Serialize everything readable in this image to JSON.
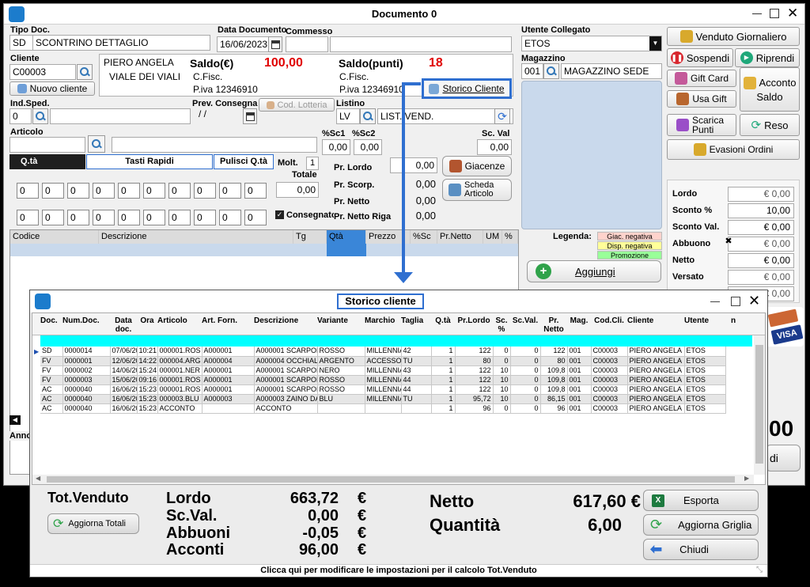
{
  "main": {
    "title": "Documento 0",
    "tipo_doc": {
      "label": "Tipo Doc.",
      "code": "SD",
      "desc": "SCONTRINO DETTAGLIO"
    },
    "data_doc": {
      "label": "Data Documento",
      "value": "16/06/2023"
    },
    "commesso": {
      "label": "Commesso"
    },
    "utente": {
      "label": "Utente Collegato",
      "value": "ETOS"
    },
    "cliente": {
      "label": "Cliente",
      "code": "C00003",
      "new_btn": "Nuovo cliente",
      "name": "PIERO ANGELA",
      "address": "VIALE DEI VIALI"
    },
    "saldo_eur": {
      "label": "Saldo(€)",
      "value": "100,00",
      "cfisc": "C.Fisc.",
      "piva": "P.iva 12346910"
    },
    "saldo_punti": {
      "label": "Saldo(punti)",
      "value": "18",
      "cfisc": "C.Fisc.",
      "piva": "P.iva 12346910"
    },
    "storico_btn": "Storico Cliente",
    "magazzino": {
      "label": "Magazzino",
      "code": "001",
      "desc": "MAGAZZINO SEDE"
    },
    "ind_sped": {
      "label": "Ind.Sped.",
      "value": "0"
    },
    "prev_consegna": {
      "label": "Prev. Consegna",
      "value": "/ /"
    },
    "cod_lotteria": "Cod. Lotteria",
    "listino": {
      "label": "Listino",
      "code": "LV",
      "desc": "LIST. VEND."
    },
    "articolo": {
      "label": "Articolo"
    },
    "sc1": {
      "label": "%Sc1",
      "value": "0,00"
    },
    "sc2": {
      "label": "%Sc2",
      "value": "0,00"
    },
    "scval": {
      "label": "Sc. Val",
      "value": "0,00"
    },
    "tabs": {
      "qta": "Q.tà",
      "tasti": "Tasti Rapidi",
      "pulisci": "Pulisci Q.tà"
    },
    "qty_cells": [
      "0",
      "0",
      "0",
      "0",
      "0",
      "0",
      "0",
      "0",
      "0",
      "0"
    ],
    "molt": {
      "label": "Molt.",
      "value": "1"
    },
    "totale": {
      "label": "Totale",
      "value": "0,00"
    },
    "consegnato": "Consegnato",
    "prezzi": {
      "lordo": {
        "label": "Pr. Lordo",
        "value": "0,00"
      },
      "scorp": {
        "label": "Pr. Scorp.",
        "value": "0,00"
      },
      "netto": {
        "label": "Pr. Netto",
        "value": "0,00"
      },
      "netto_riga": {
        "label": "Pr. Netto Riga",
        "value": "0,00"
      }
    },
    "giacenze": "Giacenze",
    "scheda": "Scheda Articolo",
    "grid_cols": [
      "Codice",
      "Descrizione",
      "Tg",
      "Qtà",
      "Prezzo",
      "%Sc",
      "Pr.Netto",
      "UM",
      "%"
    ],
    "legenda": {
      "label": "Legenda:",
      "giac": "Giac. negativa",
      "disp": "Disp. negativa",
      "promo": "Promozione"
    },
    "aggiungi": "Aggiungi",
    "anno": "Anno",
    "right_buttons": {
      "venduto": "Venduto Giornaliero",
      "sospendi": "Sospendi",
      "riprendi": "Riprendi",
      "gift_card": "Gift Card",
      "acconto": "Acconto",
      "usa_gift": "Usa Gift",
      "saldo": "Saldo",
      "scarica_punti": "Scarica Punti",
      "reso": "Reso",
      "evasioni": "Evasioni Ordini"
    },
    "summary": [
      {
        "label": "Lordo",
        "value": "€ 0,00"
      },
      {
        "label": "Sconto %",
        "value": "10,00"
      },
      {
        "label": "Sconto Val.",
        "value": "€ 0,00"
      },
      {
        "label": "Abbuono",
        "value": "€ 0,00"
      },
      {
        "label": "Netto",
        "value": "€ 0,00"
      },
      {
        "label": "Versato",
        "value": "€ 0,00"
      },
      {
        "label": "",
        "value": "€ 0,00"
      }
    ],
    "big_total_partial": "00",
    "chiudi_partial": "di"
  },
  "storico": {
    "title": "Storico cliente",
    "columns": [
      "Doc.",
      "Num.Doc.",
      "Data doc.",
      "Ora",
      "Articolo",
      "Art. Forn.",
      "Descrizione",
      "Variante",
      "Marchio",
      "Taglia",
      "Q.tà",
      "Pr.Lordo",
      "Sc. %",
      "Sc.Val.",
      "Pr. Netto",
      "Mag.",
      "Cod.Cli.",
      "Cliente",
      "Utente",
      "n"
    ],
    "rows": [
      [
        "SD",
        "0000014",
        "07/06/20",
        "10:21",
        "000001.ROS",
        "A000001",
        "A000001 SCARPONC",
        "ROSSO",
        "MILLENNIAL",
        "42",
        "1",
        "122",
        "0",
        "0",
        "122",
        "001",
        "C00003",
        "PIERO ANGELA",
        "ETOS"
      ],
      [
        "FV",
        "0000001",
        "12/06/20",
        "14:22",
        "000004.ARG",
        "A000004",
        "A000004 OCCHIALI",
        "ARGENTO",
        "ACCESSOR",
        "TU",
        "1",
        "80",
        "0",
        "0",
        "80",
        "001",
        "C00003",
        "PIERO ANGELA",
        "ETOS"
      ],
      [
        "FV",
        "0000002",
        "14/06/20",
        "15:24",
        "000001.NER",
        "A000001",
        "A000001 SCARPONC",
        "NERO",
        "MILLENNIAL",
        "43",
        "1",
        "122",
        "10",
        "0",
        "109,8",
        "001",
        "C00003",
        "PIERO ANGELA",
        "ETOS"
      ],
      [
        "FV",
        "0000003",
        "15/06/20",
        "09:16",
        "000001.ROS",
        "A000001",
        "A000001 SCARPONC",
        "ROSSO",
        "MILLENNIAL",
        "44",
        "1",
        "122",
        "10",
        "0",
        "109,8",
        "001",
        "C00003",
        "PIERO ANGELA",
        "ETOS"
      ],
      [
        "AC",
        "0000040",
        "16/06/20",
        "15:23",
        "000001.ROS",
        "A000001",
        "A000001 SCARPONC",
        "ROSSO",
        "MILLENNIAL",
        "44",
        "1",
        "122",
        "10",
        "0",
        "109,8",
        "001",
        "C00003",
        "PIERO ANGELA",
        "ETOS"
      ],
      [
        "AC",
        "0000040",
        "16/06/20",
        "15:23",
        "000003.BLU",
        "A000003",
        "A000003 ZAINO DA",
        "BLU",
        "MILLENNIAL",
        "TU",
        "1",
        "95,72",
        "10",
        "0",
        "86,15",
        "001",
        "C00003",
        "PIERO ANGELA",
        "ETOS"
      ],
      [
        "AC",
        "0000040",
        "16/06/20",
        "15:23",
        "ACCONTO",
        "",
        "ACCONTO",
        "",
        "",
        "",
        "1",
        "96",
        "0",
        "0",
        "96",
        "001",
        "C00003",
        "PIERO ANGELA",
        "ETOS"
      ]
    ],
    "tot_venduto": "Tot.Venduto",
    "aggiorna_totali": "Aggiorna Totali",
    "lordo": {
      "label": "Lordo",
      "value": "663,72"
    },
    "scval": {
      "label": "Sc.Val.",
      "value": "0,00"
    },
    "abbuoni": {
      "label": "Abbuoni",
      "value": "-0,05"
    },
    "acconti": {
      "label": "Acconti",
      "value": "96,00"
    },
    "currency": "€",
    "netto": {
      "label": "Netto",
      "value": "617,60 €"
    },
    "quantita": {
      "label": "Quantità",
      "value": "6,00"
    },
    "esporta": "Esporta",
    "aggiorna_griglia": "Aggiorna Griglia",
    "chiudi": "Chiudi",
    "status": "Clicca qui per modificare le impostazioni per il calcolo Tot.Venduto"
  },
  "colors": {
    "accent_blue": "#2f6fd0",
    "saldo_red": "#e00000",
    "selected_row": "#00ffff",
    "qty_col": "#3a86d8"
  }
}
